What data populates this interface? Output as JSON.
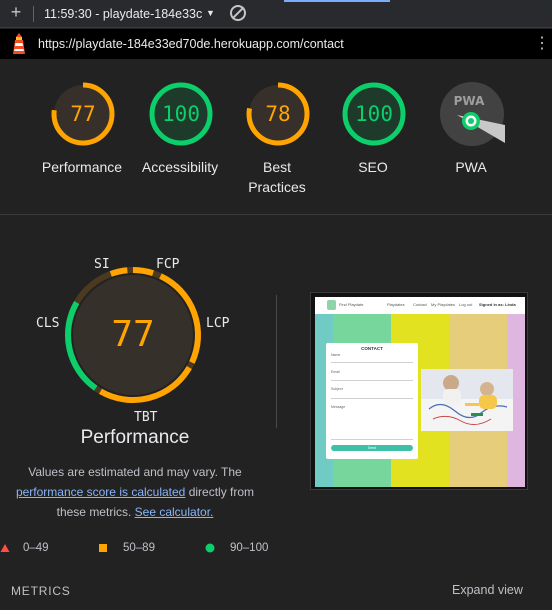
{
  "toolbar": {
    "new_report_icon": "plus-icon",
    "report_label": "11:59:30 - playdate-184e33c",
    "report_menu_icon": "caret-down-icon",
    "clear_icon": "block-icon"
  },
  "urlbar": {
    "logo_icon": "lighthouse-icon",
    "url": "https://playdate-184e33ed70de.herokuapp.com/contact",
    "menu_icon": "kebab-menu-icon"
  },
  "categories": [
    {
      "label": "Performance",
      "score": 77,
      "display": "77",
      "status": "average"
    },
    {
      "label": "Accessibility",
      "score": 100,
      "display": "100",
      "status": "pass"
    },
    {
      "label": "Best Practices",
      "score": 78,
      "display": "78",
      "status": "average"
    },
    {
      "label": "SEO",
      "score": 100,
      "display": "100",
      "status": "pass"
    },
    {
      "label": "PWA",
      "score": null,
      "display": "",
      "status": "pwa",
      "badge_text": "PWA"
    }
  ],
  "performance": {
    "score": "77",
    "title": "Performance",
    "metric_labels": {
      "si": "SI",
      "fcp": "FCP",
      "lcp": "LCP",
      "tbt": "TBT",
      "cls": "CLS"
    },
    "screenshot": {
      "nav_brand": "Find Playdate",
      "nav_links": [
        "Playdates",
        "Contact",
        "My Playdates",
        "Log out",
        "Signed in as: Linda"
      ],
      "form_title": "CONTACT",
      "form_fields": [
        "Name",
        "Email",
        "Subject",
        "Message"
      ],
      "form_button": "Send"
    }
  },
  "note": {
    "line1": "Values are estimated and may vary. The",
    "link1": "performance score is calculated",
    "line2_rest": " directly from",
    "line3_start": "these metrics. ",
    "link2": "See calculator."
  },
  "legend": [
    {
      "label": "0–49",
      "shape": "triangle",
      "color": "#ff4e42"
    },
    {
      "label": "50–89",
      "shape": "square",
      "color": "#ffa400"
    },
    {
      "label": "90–100",
      "shape": "circle",
      "color": "#0cce6b"
    }
  ],
  "metrics_heading": "METRICS",
  "expand_view": "Expand view",
  "colors": {
    "pass": "#0cce6b",
    "average": "#ffa400",
    "fail": "#ff4e42",
    "link": "#8ab4f8",
    "background": "#222222"
  }
}
